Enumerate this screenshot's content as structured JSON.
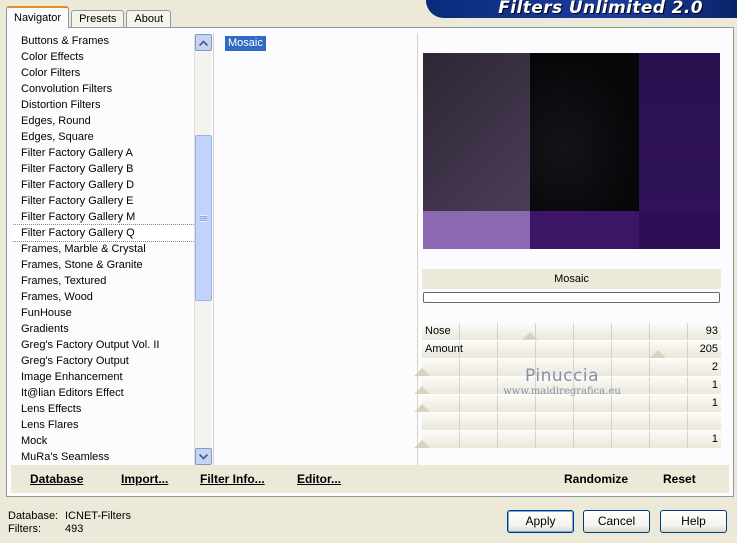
{
  "tabs": [
    "Navigator",
    "Presets",
    "About"
  ],
  "banner_title": "Filters Unlimited 2.0",
  "categories": [
    "Buttons & Frames",
    "Color Effects",
    "Color Filters",
    "Convolution Filters",
    "Distortion Filters",
    "Edges, Round",
    "Edges, Square",
    "Filter Factory Gallery A",
    "Filter Factory Gallery B",
    "Filter Factory Gallery D",
    "Filter Factory Gallery E",
    "Filter Factory Gallery M",
    "Filter Factory Gallery Q",
    "Frames, Marble & Crystal",
    "Frames, Stone & Granite",
    "Frames, Textured",
    "Frames, Wood",
    "FunHouse",
    "Gradients",
    "Greg's Factory Output Vol. II",
    "Greg's Factory Output",
    "Image Enhancement",
    "It@lian Editors Effect",
    "Lens Effects",
    "Lens Flares",
    "Mock",
    "MuRa's Seamless"
  ],
  "selected_category": "Filter Factory Gallery Q",
  "filter": "Mosaic",
  "filter_name_label": "Mosaic",
  "params": [
    {
      "label": "Nose",
      "value": "93"
    },
    {
      "label": "Amount",
      "value": "205"
    },
    {
      "label": "",
      "value": "2"
    },
    {
      "label": "",
      "value": "1"
    },
    {
      "label": "",
      "value": "1"
    },
    {
      "label": "",
      "value": ""
    },
    {
      "label": "",
      "value": "1"
    }
  ],
  "watermark": {
    "line1": "Pinuccia",
    "line2": "www.maidiregrafica.eu"
  },
  "toolbar": {
    "database": "Database",
    "import": "Import...",
    "filter_info": "Filter Info...",
    "editor": "Editor...",
    "randomize": "Randomize",
    "reset": "Reset"
  },
  "footer": {
    "database_label": "Database:",
    "database_value": "ICNET-Filters",
    "filters_label": "Filters:",
    "filters_value": "493"
  },
  "buttons": {
    "apply": "Apply",
    "cancel": "Cancel",
    "help": "Help"
  }
}
